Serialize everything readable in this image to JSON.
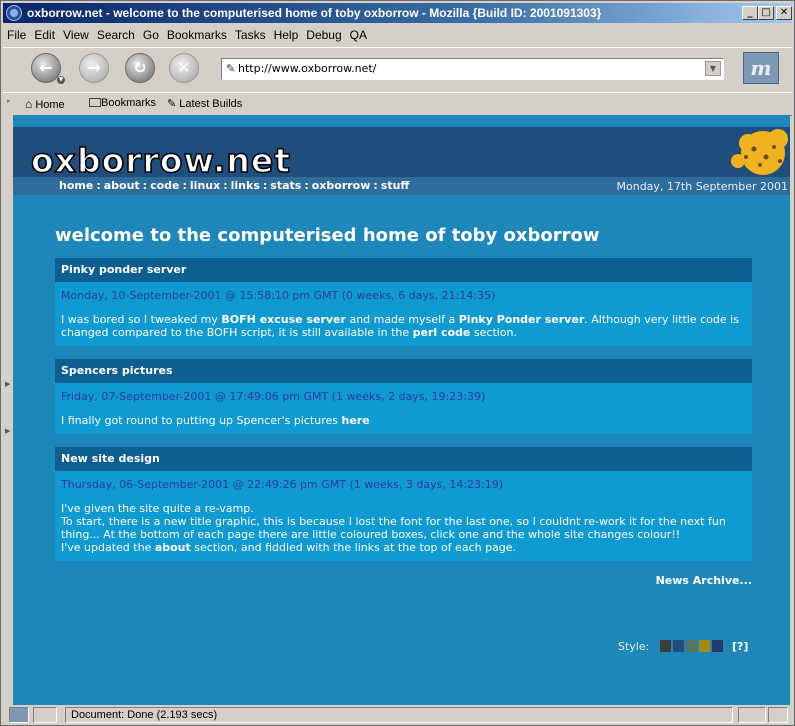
{
  "window": {
    "title": "oxborrow.net - welcome to the computerised home of toby oxborrow - Mozilla {Build ID: 2001091303}",
    "controls": [
      "_",
      "□",
      "✕"
    ]
  },
  "menubar": [
    "File",
    "Edit",
    "View",
    "Search",
    "Go",
    "Bookmarks",
    "Tasks",
    "Help",
    "Debug",
    "QA"
  ],
  "navbar": {
    "url": "http://www.oxborrow.net/",
    "throbber": "m"
  },
  "personal_toolbar": {
    "home": "Home",
    "bookmarks": "Bookmarks",
    "latest": "Latest Builds"
  },
  "site": {
    "logo": "oxborrow.net",
    "nav": [
      "home",
      "about",
      "code",
      "linux",
      "links",
      "stats",
      "oxborrow",
      "stuff"
    ],
    "date": "Monday, 17th September 2001",
    "page_title": "welcome to the computerised home of toby oxborrow",
    "news": [
      {
        "title": "Pinky ponder server",
        "date": "Monday, 10-September-2001 @ 15:58:10 pm GMT (0 weeks, 6 days, 21:14:35)",
        "body": [
          {
            "t": "I was bored so I tweaked my "
          },
          {
            "b": "BOFH excuse server"
          },
          {
            "t": " and made myself a "
          },
          {
            "b": "Pinky Ponder server"
          },
          {
            "t": ". Although very little code is changed compared to the BOFH script, it is still available in the "
          },
          {
            "b": "perl code"
          },
          {
            "t": " section."
          }
        ]
      },
      {
        "title": "Spencers pictures",
        "date": "Friday, 07-September-2001 @ 17:49:06 pm GMT (1 weeks, 2 days, 19:23:39)",
        "body": [
          {
            "t": "I finally got round to putting up Spencer's pictures "
          },
          {
            "b": "here"
          }
        ]
      },
      {
        "title": "New site design",
        "date": "Thursday, 06-September-2001 @ 22:49:26 pm GMT (1 weeks, 3 days, 14:23:19)",
        "body": [
          {
            "t": "I've given the site quite a re-vamp."
          },
          {
            "br": true
          },
          {
            "t": "To start, there is a new title graphic, this is because I lost the font for the last one, so I couldnt re-work it for the next fun thing... At the bottom of each page there are little coloured boxes, click one and the whole site changes colour!!"
          },
          {
            "br": true
          },
          {
            "t": "I've updated the "
          },
          {
            "b": "about"
          },
          {
            "t": " section, and fiddled with the links at the top of each page."
          }
        ]
      }
    ],
    "archive": "News Archive...",
    "style_label": "Style:",
    "style_help": "[?]",
    "swatches": [
      "#3c3c3c",
      "#1f4d7c",
      "#5b7361",
      "#a6880c",
      "#233a66"
    ]
  },
  "statusbar": {
    "text": "Document: Done (2.193 secs)"
  },
  "colors": {
    "page_bg": "#1e87ba",
    "banner": "#1f4d7c",
    "news_header": "#0d5f91",
    "news_body": "#0f9ad1",
    "date_text": "#2a3aa3"
  }
}
